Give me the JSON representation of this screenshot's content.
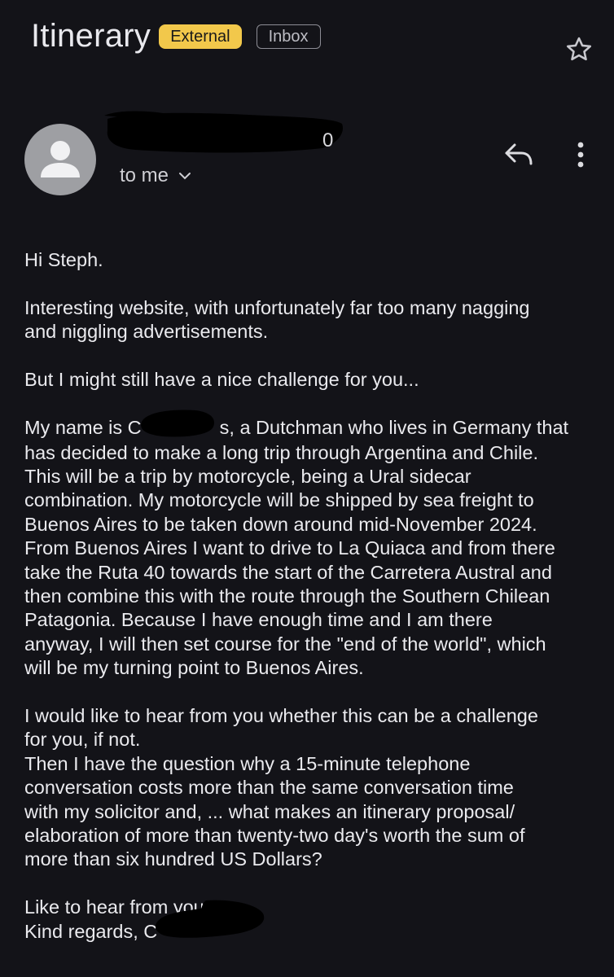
{
  "header": {
    "subject": "Itinerary",
    "external_label": "External",
    "inbox_label": "Inbox"
  },
  "sender": {
    "visible_fragment": "0",
    "recipient": "to me"
  },
  "icons": {
    "star": "star-icon",
    "reply": "reply-icon",
    "more": "more-vert-icon",
    "avatar": "person-avatar-icon",
    "chevron": "chevron-down-icon"
  },
  "colors": {
    "background": "#131318",
    "external_badge": "#f2c84b",
    "avatar": "#9e9fa3"
  },
  "body": {
    "greeting": "Hi Steph.",
    "p1": "Interesting website, with unfortunately far too many nagging\nand niggling advertisements.",
    "p2": "But I might still have a nice challenge for you...",
    "p3_prefix": "My name is C",
    "p3_after_name": "s, a Dutchman who lives in Germany that",
    "p3_rest": "has decided to make a long trip through Argentina and Chile.\nThis will be a trip by motorcycle, being a Ural sidecar\ncombination. My motorcycle will be shipped by sea freight to\nBuenos Aires to be taken down around mid-November 2024.\nFrom Buenos Aires I want to drive to La Quiaca and from there\ntake the Ruta 40 towards the start of the Carretera Austral and\nthen combine this with the route through the Southern Chilean\nPatagonia. Because I have enough time and I am there\nanyway, I will then set course for the \"end of the world\", which\nwill be my turning point to Buenos Aires.",
    "p4": "I would like to hear from you whether this can be a challenge\nfor you, if not.\nThen I have the question why a 15-minute telephone\nconversation costs more than the same conversation time\nwith my solicitor and, ... what makes an itinerary proposal/\nelaboration of more than twenty-two day's worth the sum of\nmore than six hundred US Dollars?",
    "closing1": "Like to hear from you",
    "closing2_prefix": "Kind regards, C"
  }
}
